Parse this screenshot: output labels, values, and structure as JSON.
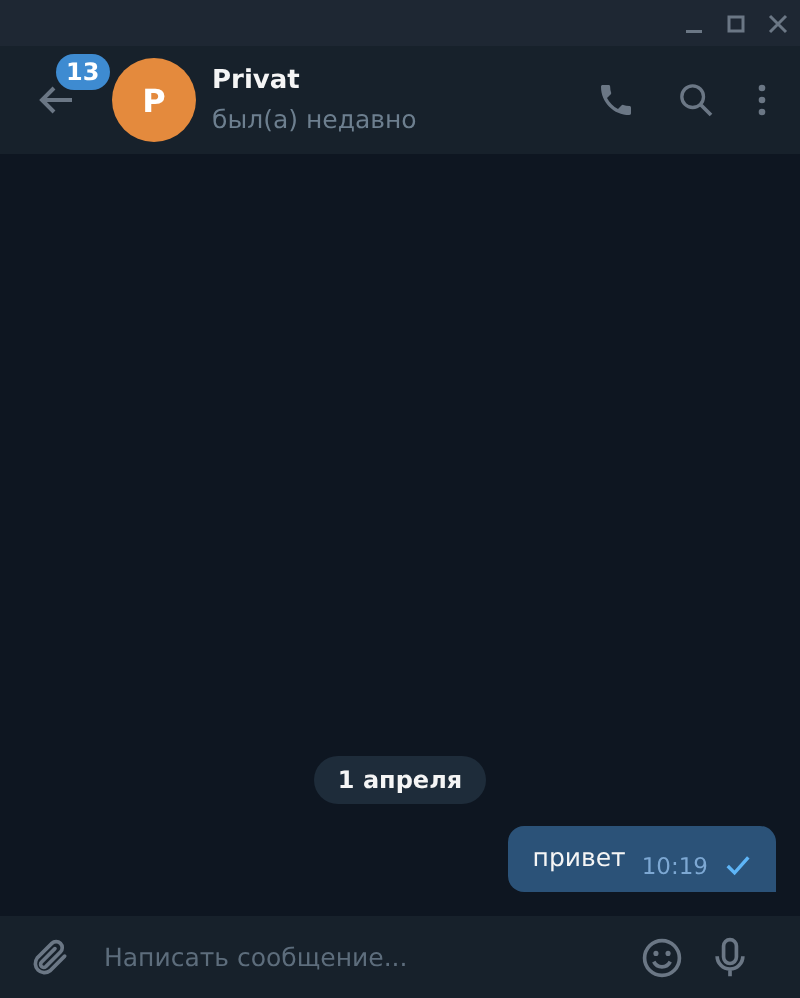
{
  "header": {
    "unread_count": "13",
    "avatar_letter": "P",
    "name": "Privat",
    "status": "был(а) недавно"
  },
  "date_chip": "1 апреля",
  "messages": [
    {
      "text": "привет",
      "time": "10:19",
      "outgoing": true,
      "read": false
    }
  ],
  "composer": {
    "placeholder": "Написать сообщение..."
  }
}
